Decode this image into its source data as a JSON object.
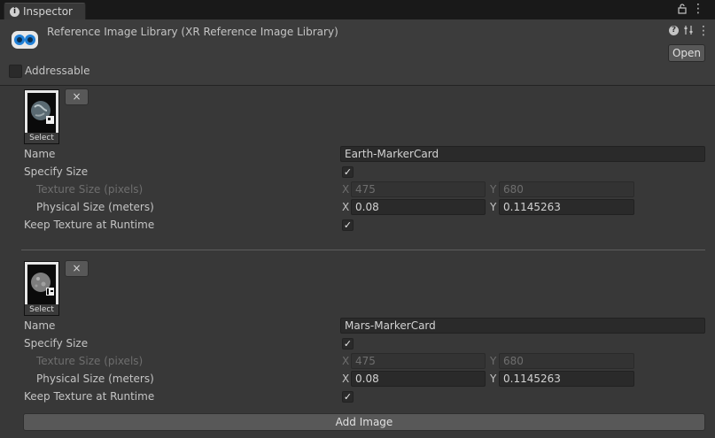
{
  "tab": {
    "label": "Inspector"
  },
  "header": {
    "title": "Reference Image Library (XR Reference Image Library)",
    "open_label": "Open",
    "addressable_label": "Addressable"
  },
  "images": [
    {
      "thumb_label": "Select",
      "remove_label": "×",
      "name_label": "Name",
      "name_value": "Earth-MarkerCard",
      "specify_size_label": "Specify Size",
      "specify_size_checked": true,
      "texture_size_label": "Texture Size (pixels)",
      "texture_x": "475",
      "texture_y": "680",
      "physical_size_label": "Physical Size (meters)",
      "physical_x": "0.08",
      "physical_y": "0.1145263",
      "keep_texture_label": "Keep Texture at Runtime",
      "keep_texture_checked": true,
      "x_axis": "X",
      "y_axis": "Y"
    },
    {
      "thumb_label": "Select",
      "remove_label": "×",
      "name_label": "Name",
      "name_value": "Mars-MarkerCard",
      "specify_size_label": "Specify Size",
      "specify_size_checked": true,
      "texture_size_label": "Texture Size (pixels)",
      "texture_x": "475",
      "texture_y": "680",
      "physical_size_label": "Physical Size (meters)",
      "physical_x": "0.08",
      "physical_y": "0.1145263",
      "keep_texture_label": "Keep Texture at Runtime",
      "keep_texture_checked": true,
      "x_axis": "X",
      "y_axis": "Y"
    }
  ],
  "add_image_label": "Add Image",
  "checkmark": "✓"
}
